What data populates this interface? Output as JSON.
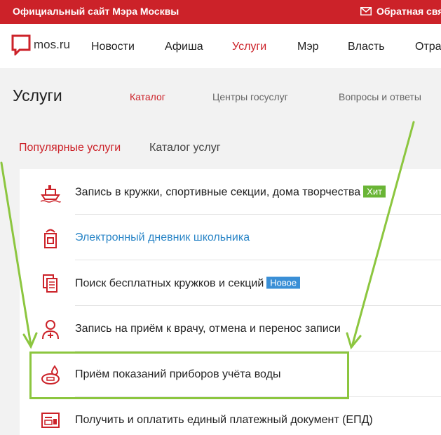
{
  "topbar": {
    "site_title": "Официальный сайт Мэра Москвы",
    "feedback": "Обратная свя"
  },
  "nav": {
    "logo_text": "mos.ru",
    "items": [
      "Новости",
      "Афиша",
      "Услуги",
      "Мэр",
      "Власть",
      "Отра"
    ],
    "active_item": "Услуги"
  },
  "section": {
    "title": "Услуги",
    "subnav": [
      "Каталог",
      "Центры госуслуг",
      "Вопросы и ответы"
    ],
    "active_subnav": "Каталог"
  },
  "tabs": {
    "popular": "Популярные услуги",
    "catalog": "Каталог услуг"
  },
  "services": [
    {
      "label": "Запись в кружки, спортивные секции, дома творчества",
      "badge": "Хит",
      "icon": "ship-icon"
    },
    {
      "label": "Электронный дневник школьника",
      "badge": "",
      "icon": "school-diary-icon"
    },
    {
      "label": "Поиск бесплатных кружков и секций",
      "badge": "Новое",
      "icon": "documents-icon"
    },
    {
      "label": "Запись на приём к врачу, отмена и перенос записи",
      "badge": "",
      "icon": "doctor-icon"
    },
    {
      "label": "Приём показаний приборов учёта воды",
      "badge": "",
      "icon": "water-meter-icon"
    },
    {
      "label": "Получить и оплатить единый платежный документ (ЕПД)",
      "badge": "",
      "icon": "payment-document-icon"
    }
  ],
  "colors": {
    "brand_red": "#cc2229",
    "link_blue": "#2b86c7",
    "badge_hit": "#6ab536",
    "badge_new": "#3a8fd6",
    "annotation_green": "#8cc63f"
  }
}
